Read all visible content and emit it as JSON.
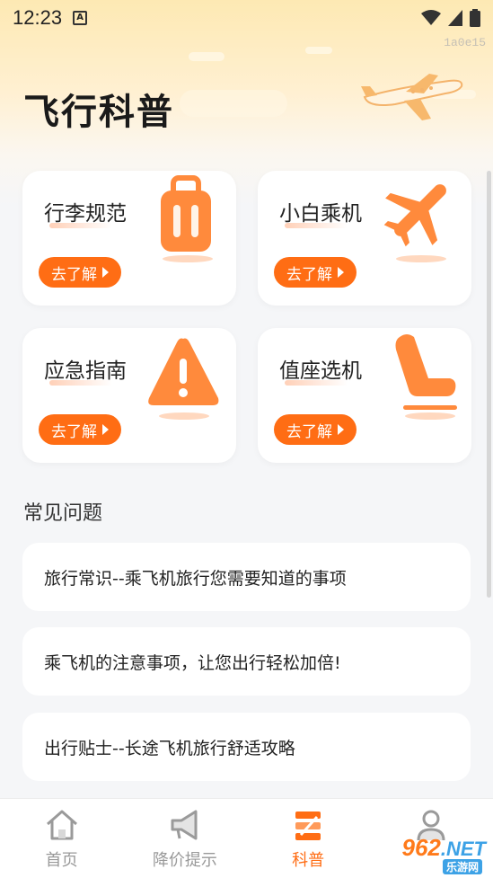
{
  "status_bar": {
    "time": "12:23",
    "badge": "A"
  },
  "watermark": "1a0e15",
  "page": {
    "title": "飞行科普"
  },
  "cards": [
    {
      "title": "行李规范",
      "button": "去了解",
      "icon": "luggage-icon"
    },
    {
      "title": "小白乘机",
      "button": "去了解",
      "icon": "airplane-icon"
    },
    {
      "title": "应急指南",
      "button": "去了解",
      "icon": "warning-icon"
    },
    {
      "title": "值座选机",
      "button": "去了解",
      "icon": "seat-icon"
    }
  ],
  "faq": {
    "title": "常见问题",
    "items": [
      "旅行常识--乘飞机旅行您需要知道的事项",
      "乘飞机的注意事项，让您出行轻松加倍!",
      "出行贴士--长途飞机旅行舒适攻略"
    ]
  },
  "tabs": [
    {
      "label": "首页",
      "icon": "home-icon",
      "active": false
    },
    {
      "label": "降价提示",
      "icon": "megaphone-icon",
      "active": false
    },
    {
      "label": "科普",
      "icon": "science-icon",
      "active": true
    },
    {
      "label": "",
      "icon": "profile-icon",
      "active": false
    }
  ],
  "logo": {
    "brand": "962",
    "suffix": ".NET",
    "sub": "乐游网"
  },
  "colors": {
    "accent": "#ff6d14",
    "background": "#f5f6f8"
  }
}
